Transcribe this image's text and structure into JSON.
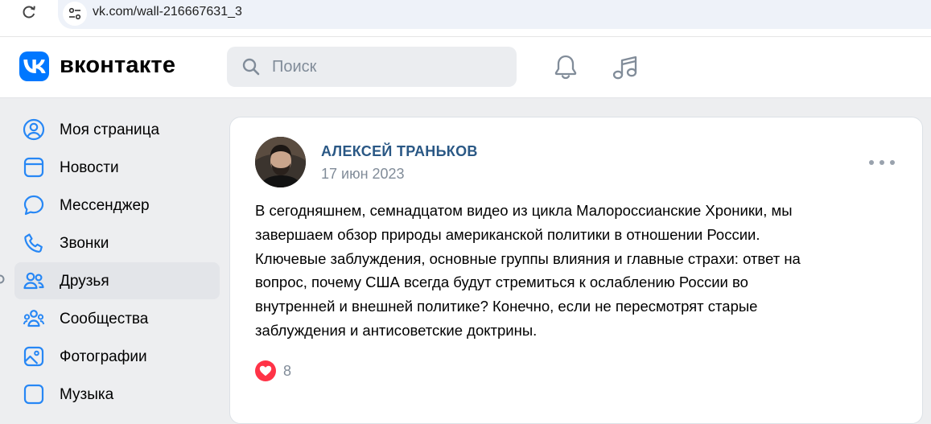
{
  "browser": {
    "url": "vk.com/wall-216667631_3"
  },
  "header": {
    "logo_text": "вконтакте",
    "search_placeholder": "Поиск",
    "icons": [
      "bell-icon",
      "music-icon"
    ]
  },
  "sidebar": {
    "items": [
      {
        "label": "Моя страница",
        "icon": "user-circle-icon"
      },
      {
        "label": "Новости",
        "icon": "news-icon"
      },
      {
        "label": "Мессенджер",
        "icon": "chat-bubble-icon"
      },
      {
        "label": "Звонки",
        "icon": "phone-icon"
      },
      {
        "label": "Друзья",
        "icon": "friends-icon"
      },
      {
        "label": "Сообщества",
        "icon": "communities-icon"
      },
      {
        "label": "Фотографии",
        "icon": "photo-icon"
      },
      {
        "label": "Музыка",
        "icon": "music-icon"
      }
    ],
    "active_label": "Друзья"
  },
  "post": {
    "author": "АЛЕКСЕЙ ТРАНЬКОВ",
    "date": "17 июн 2023",
    "text_lines": [
      "В сегодняшнем, семнадцатом видео из цикла Малороссианские Хроники, мы",
      "завершаем обзор природы американской политики в отношении России.",
      "Ключевые заблуждения, основные группы влияния и главные страхи: ответ на",
      "вопрос, почему США всегда будут стремиться к ослаблению России во",
      "внутренней и внешней политике? Конечно, если не пересмотрят старые",
      "заблуждения и антисоветские доктрины."
    ],
    "likes": "8"
  },
  "colors": {
    "brand": "#0077ff",
    "author_link": "#2a5885",
    "like": "#ff3347",
    "background": "#edeef0"
  }
}
